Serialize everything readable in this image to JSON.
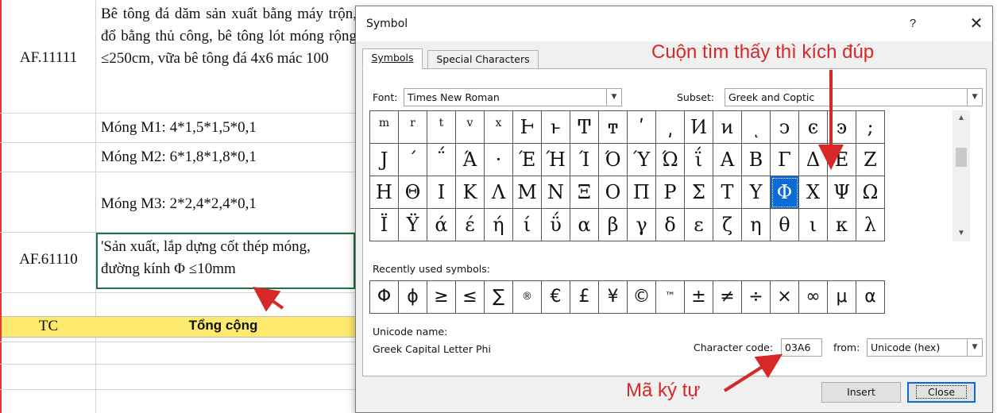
{
  "sheet": {
    "rows": [
      {
        "code": "AF.11111",
        "desc": "Bê tông đá dăm sản xuất bằng máy trộn, đổ bằng thủ công, bê tông lót móng rộng ≤250cm, vữa bê tông đá 4x6 mác 100"
      },
      {
        "code": "",
        "desc": "Móng M1: 4*1,5*1,5*0,1"
      },
      {
        "code": "",
        "desc": "Móng M2: 6*1,8*1,8*0,1"
      },
      {
        "code": "",
        "desc": "Móng M3: 2*2,4*2,4*0,1"
      },
      {
        "code": "AF.61110",
        "desc": "'Sản xuất, lắp dựng cốt thép móng, đường kính Φ ≤10mm"
      }
    ],
    "total": {
      "code": "TC",
      "label": "Tổng cộng"
    }
  },
  "dialog": {
    "title": "Symbol",
    "help": "?",
    "close_glyph": "✕",
    "tabs": [
      "Symbols",
      "Special Characters"
    ],
    "font_label": "Font:",
    "font_value": "Times New Roman",
    "subset_label": "Subset:",
    "subset_value": "Greek and Coptic",
    "grid": [
      [
        "m",
        "r",
        "t",
        "v",
        "x",
        "Ͱ",
        "ͱ",
        "Ͳ",
        "ͳ",
        "ʹ",
        "͵",
        "Ͷ",
        "ͷ",
        "ͺ",
        "ͻ",
        "ͼ",
        "ͽ",
        ";"
      ],
      [
        "Ϳ",
        "΄",
        "΅",
        "Ά",
        "·",
        "Έ",
        "Ή",
        "Ί",
        "Ό",
        "Ύ",
        "Ώ",
        "ΐ",
        "Α",
        "Β",
        "Γ",
        "Δ",
        "Ε",
        "Ζ"
      ],
      [
        "Η",
        "Θ",
        "Ι",
        "Κ",
        "Λ",
        "Μ",
        "Ν",
        "Ξ",
        "Ο",
        "Π",
        "Ρ",
        "Σ",
        "Τ",
        "Υ",
        "Φ",
        "Χ",
        "Ψ",
        "Ω"
      ],
      [
        "Ϊ",
        "Ϋ",
        "ά",
        "έ",
        "ή",
        "ί",
        "ΰ",
        "α",
        "β",
        "γ",
        "δ",
        "ε",
        "ζ",
        "η",
        "θ",
        "ι",
        "κ",
        "λ"
      ]
    ],
    "selected_symbol": "Φ",
    "recent_label": "Recently used symbols:",
    "recent": [
      "Φ",
      "ϕ",
      "≥",
      "≤",
      "∑",
      "®",
      "€",
      "£",
      "¥",
      "©",
      "™",
      "±",
      "≠",
      "÷",
      "×",
      "∞",
      "μ",
      "α"
    ],
    "unicode_name_label": "Unicode name:",
    "unicode_name": "Greek Capital Letter Phi",
    "char_code_label": "Character code:",
    "char_code": "03A6",
    "from_label": "from:",
    "from_value": "Unicode (hex)",
    "insert_label": "Insert",
    "close_label": "Close"
  },
  "annotations": {
    "scroll_hint": "Cuộn tìm thấy thì kích đúp",
    "code_hint": "Mã ký tự"
  },
  "colors": {
    "annotation": "#d62828",
    "selection": "#0a6bd6",
    "total_row": "#fde96d"
  }
}
